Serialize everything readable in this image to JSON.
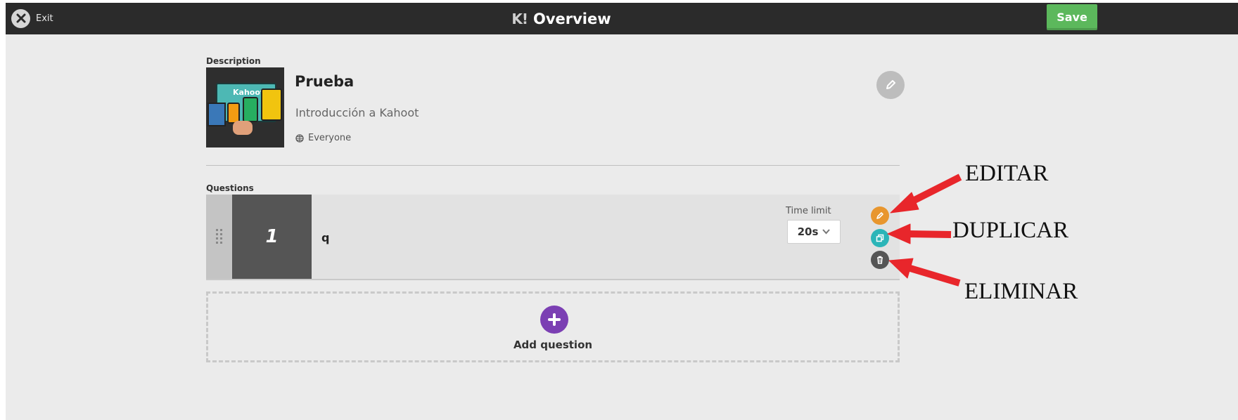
{
  "topbar": {
    "exit_label": "Exit",
    "logo_text": "K!",
    "title": "Overview",
    "save_label": "Save"
  },
  "description": {
    "section_label": "Description",
    "cover_text": "Kahoot!",
    "title": "Prueba",
    "subtitle": "Introducción a Kahoot",
    "visibility": "Everyone"
  },
  "questions": {
    "section_label": "Questions",
    "items": [
      {
        "number": "1",
        "text": "q",
        "time_limit_label": "Time limit",
        "time_limit_value": "20s"
      }
    ],
    "add_label": "Add question"
  },
  "annotations": {
    "edit": "EDITAR",
    "duplicate": "DUPLICAR",
    "delete": "ELIMINAR"
  },
  "colors": {
    "topbar": "#2b2b2b",
    "save": "#5cb85c",
    "edit_action": "#e8962e",
    "duplicate_action": "#2bb5b8",
    "delete_action": "#555555",
    "add_question": "#7b3fb3",
    "arrow": "#e8262b"
  },
  "icons": {
    "exit": "close-icon",
    "edit": "pencil-icon",
    "visibility": "globe-icon",
    "duplicate": "duplicate-icon",
    "delete": "trash-icon",
    "add": "plus-icon",
    "drag": "drag-handle-icon",
    "dropdown": "chevron-down-icon"
  }
}
